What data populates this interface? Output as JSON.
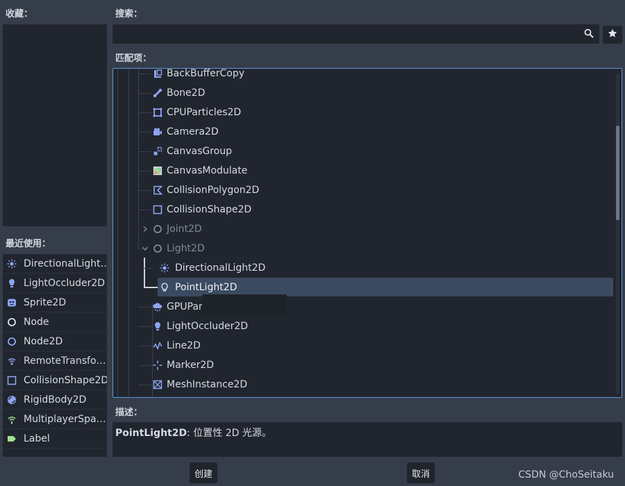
{
  "favorites": {
    "label": "收藏："
  },
  "recent": {
    "label": "最近使用：",
    "items": [
      {
        "label": "DirectionalLight…",
        "icon": "directional-light-icon"
      },
      {
        "label": "LightOccluder2D",
        "icon": "light-occluder-icon"
      },
      {
        "label": "Sprite2D",
        "icon": "sprite-icon"
      },
      {
        "label": "Node",
        "icon": "node-icon"
      },
      {
        "label": "Node2D",
        "icon": "node2d-icon"
      },
      {
        "label": "RemoteTransfo…",
        "icon": "remote-transform-icon"
      },
      {
        "label": "CollisionShape2D",
        "icon": "collision-shape-icon"
      },
      {
        "label": "RigidBody2D",
        "icon": "rigidbody-icon"
      },
      {
        "label": "MultiplayerSpa…",
        "icon": "multiplayer-spawner-icon"
      },
      {
        "label": "Label",
        "icon": "label-icon"
      }
    ]
  },
  "search": {
    "label": "搜索：",
    "value": "",
    "placeholder": ""
  },
  "matches": {
    "label": "匹配项：",
    "items": [
      {
        "label": "BackBufferCopy",
        "icon": "backbuffer-icon"
      },
      {
        "label": "Bone2D",
        "icon": "bone-icon"
      },
      {
        "label": "CPUParticles2D",
        "icon": "particles-icon"
      },
      {
        "label": "Camera2D",
        "icon": "camera-icon"
      },
      {
        "label": "CanvasGroup",
        "icon": "canvas-group-icon"
      },
      {
        "label": "CanvasModulate",
        "icon": "canvas-modulate-icon"
      },
      {
        "label": "CollisionPolygon2D",
        "icon": "collision-polygon-icon"
      },
      {
        "label": "CollisionShape2D",
        "icon": "collision-shape-icon"
      },
      {
        "label": "Joint2D",
        "icon": "joint-icon"
      },
      {
        "label": "Light2D",
        "icon": "light2d-icon"
      },
      {
        "label": "DirectionalLight2D",
        "icon": "directional-light-icon"
      },
      {
        "label": "PointLight2D",
        "icon": "point-light-icon"
      },
      {
        "label": "GPUPar",
        "icon": "gpu-particles-icon"
      },
      {
        "label": "LightOccluder2D",
        "icon": "light-occluder-icon"
      },
      {
        "label": "Line2D",
        "icon": "line-icon"
      },
      {
        "label": "Marker2D",
        "icon": "marker-icon"
      },
      {
        "label": "MeshInstance2D",
        "icon": "mesh-instance-icon"
      }
    ]
  },
  "description": {
    "label": "描述：",
    "name": "PointLight2D",
    "text": ": 位置性 2D 光源。"
  },
  "buttons": {
    "create": "创建",
    "cancel": "取消"
  },
  "watermark": "CSDN @ChoSeitaku",
  "colors": {
    "accent": "#5a99d6",
    "icon_blue": "#8da5f3",
    "background": "#363d4a",
    "panel": "#21252e"
  }
}
